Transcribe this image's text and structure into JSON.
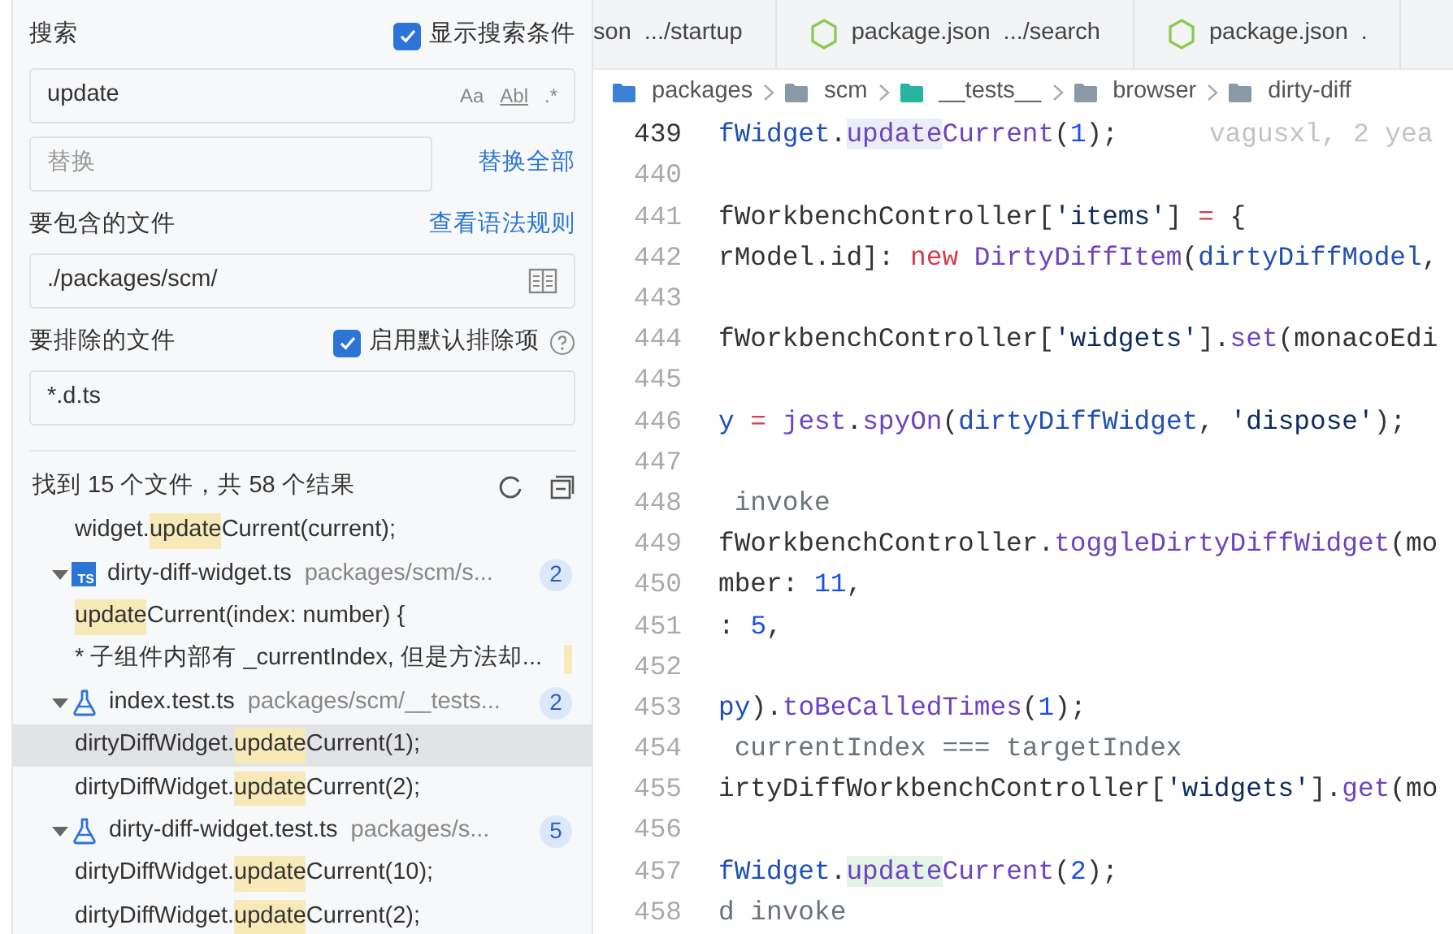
{
  "search_panel": {
    "title": "搜索",
    "show_conditions": {
      "label": "显示搜索条件",
      "checked": true
    },
    "search_field": {
      "value": "update",
      "options": [
        {
          "label": "Aa",
          "kind": "case"
        },
        {
          "label": "Abl",
          "kind": "word"
        },
        {
          "label": ".*",
          "kind": "regex"
        }
      ]
    },
    "replace_field": {
      "placeholder": "替换"
    },
    "replace_all": "替换全部",
    "include": {
      "label": "要包含的文件",
      "link": "查看语法规则",
      "value": "./packages/scm/"
    },
    "exclude": {
      "label": "要排除的文件",
      "use_defaults": {
        "label": "启用默认排除项",
        "checked": true
      },
      "value": "*.d.ts"
    },
    "summary": "找到 15 个文件，共 58 个结果",
    "leading_matches": [
      {
        "before": "widget.",
        "match": "update",
        "after": "Current(current);",
        "selected": false,
        "trailing_match": false
      }
    ],
    "files": [
      {
        "name": "dirty-diff-widget.ts",
        "path": "packages/scm/s...",
        "count": "2",
        "kind": "ts",
        "badge_label": "TS",
        "expanded": true,
        "children": [
          {
            "match": "update",
            "after": "Current(index: number) {",
            "selected": false,
            "trailing_match": false
          },
          {
            "before": "* 子组件内部有 _currentIndex, 但是方法却...",
            "selected": false,
            "trailing_match": true
          }
        ]
      },
      {
        "name": "index.test.ts",
        "path": "packages/scm/__tests...",
        "count": "2",
        "kind": "test",
        "expanded": true,
        "children": [
          {
            "before": "dirtyDiffWidget.",
            "match": "update",
            "after": "Current(1);",
            "selected": true,
            "trailing_match": false
          },
          {
            "before": "dirtyDiffWidget.",
            "match": "update",
            "after": "Current(2);",
            "selected": false,
            "trailing_match": false
          }
        ]
      },
      {
        "name": "dirty-diff-widget.test.ts",
        "path": "packages/s...",
        "count": "5",
        "kind": "test",
        "expanded": true,
        "children": [
          {
            "before": "dirtyDiffWidget.",
            "match": "update",
            "after": "Current(10);",
            "selected": false,
            "trailing_match": false
          },
          {
            "before": "dirtyDiffWidget.",
            "match": "update",
            "after": "Current(2);",
            "selected": false,
            "trailing_match": false
          }
        ]
      }
    ]
  },
  "editor": {
    "tabs": [
      {
        "name": "son",
        "dir": ".../startup",
        "icon": false,
        "selected": false
      },
      {
        "name": "package.json",
        "dir": ".../search",
        "icon": true,
        "selected": false
      },
      {
        "name": "package.json",
        "dir": ".",
        "icon": true,
        "selected": false
      }
    ],
    "breadcrumbs": [
      {
        "label": "packages",
        "color": "#3b82d6"
      },
      {
        "label": "scm",
        "color": "#8a99a6"
      },
      {
        "label": "__tests__",
        "color": "#26b5a0"
      },
      {
        "label": "browser",
        "color": "#8a99a6"
      },
      {
        "label": "dirty-diff",
        "color": "#8a99a6"
      }
    ],
    "lines": [
      {
        "number": "439",
        "current": true,
        "blame": "vagusxl, 2 yea",
        "tokens": [
          {
            "t": "fWidget",
            "kind": "var"
          },
          {
            "t": ".",
            "kind": "plain"
          },
          {
            "t": "update",
            "kind": "selection"
          },
          {
            "t": "Current",
            "kind": "fn"
          },
          {
            "t": "(",
            "kind": "plain"
          },
          {
            "t": "1",
            "kind": "num"
          },
          {
            "t": ");",
            "kind": "plain"
          }
        ]
      },
      {
        "number": "440",
        "current": false
      },
      {
        "number": "441",
        "current": false,
        "tokens": [
          {
            "t": "fWorkbenchController[",
            "kind": "plain"
          },
          {
            "t": "'items'",
            "kind": "str"
          },
          {
            "t": "] ",
            "kind": "plain"
          },
          {
            "t": "=",
            "kind": "kw"
          },
          {
            "t": " {",
            "kind": "plain"
          }
        ]
      },
      {
        "number": "442",
        "current": false,
        "tokens": [
          {
            "t": "rModel.id]: ",
            "kind": "plain"
          },
          {
            "t": "new",
            "kind": "kw"
          },
          {
            "t": " DirtyDiffItem",
            "kind": "fn"
          },
          {
            "t": "(",
            "kind": "plain"
          },
          {
            "t": "dirtyDiffModel",
            "kind": "var"
          },
          {
            "t": ",",
            "kind": "plain"
          }
        ]
      },
      {
        "number": "443",
        "current": false
      },
      {
        "number": "444",
        "current": false,
        "tokens": [
          {
            "t": "fWorkbenchController[",
            "kind": "plain"
          },
          {
            "t": "'widgets'",
            "kind": "str"
          },
          {
            "t": "].",
            "kind": "plain"
          },
          {
            "t": "set",
            "kind": "fn"
          },
          {
            "t": "(monacoEdi",
            "kind": "plain"
          }
        ]
      },
      {
        "number": "445",
        "current": false
      },
      {
        "number": "446",
        "current": false,
        "tokens": [
          {
            "t": "y",
            "kind": "var"
          },
          {
            "t": " = ",
            "kind": "kw"
          },
          {
            "t": "jest",
            "kind": "fn"
          },
          {
            "t": ".",
            "kind": "plain"
          },
          {
            "t": "spyOn",
            "kind": "fn"
          },
          {
            "t": "(",
            "kind": "plain"
          },
          {
            "t": "dirtyDiffWidget",
            "kind": "var"
          },
          {
            "t": ", ",
            "kind": "plain"
          },
          {
            "t": "'dispose'",
            "kind": "str"
          },
          {
            "t": ");",
            "kind": "plain"
          }
        ]
      },
      {
        "number": "447",
        "current": false
      },
      {
        "number": "448",
        "current": false,
        "tokens": [
          {
            "t": " invoke",
            "kind": "comment"
          }
        ]
      },
      {
        "number": "449",
        "current": false,
        "tokens": [
          {
            "t": "fWorkbenchController.",
            "kind": "plain"
          },
          {
            "t": "toggleDirtyDiffWidget",
            "kind": "fn"
          },
          {
            "t": "(mo",
            "kind": "plain"
          }
        ]
      },
      {
        "number": "450",
        "current": false,
        "tokens": [
          {
            "t": "mber: ",
            "kind": "plain"
          },
          {
            "t": "11",
            "kind": "num"
          },
          {
            "t": ",",
            "kind": "plain"
          }
        ]
      },
      {
        "number": "451",
        "current": false,
        "tokens": [
          {
            "t": ": ",
            "kind": "plain"
          },
          {
            "t": "5",
            "kind": "num"
          },
          {
            "t": ",",
            "kind": "plain"
          }
        ]
      },
      {
        "number": "452",
        "current": false
      },
      {
        "number": "453",
        "current": false,
        "tokens": [
          {
            "t": "py",
            "kind": "var"
          },
          {
            "t": ").",
            "kind": "plain"
          },
          {
            "t": "toBeCalledTimes",
            "kind": "fn"
          },
          {
            "t": "(",
            "kind": "plain"
          },
          {
            "t": "1",
            "kind": "num"
          },
          {
            "t": ");",
            "kind": "plain"
          }
        ]
      },
      {
        "number": "454",
        "current": false,
        "tokens": [
          {
            "t": " currentIndex === targetIndex",
            "kind": "comment"
          }
        ]
      },
      {
        "number": "455",
        "current": false,
        "tokens": [
          {
            "t": "irtyDiffWorkbenchController[",
            "kind": "plain"
          },
          {
            "t": "'widgets'",
            "kind": "str"
          },
          {
            "t": "].",
            "kind": "plain"
          },
          {
            "t": "get",
            "kind": "fn"
          },
          {
            "t": "(mo",
            "kind": "plain"
          }
        ]
      },
      {
        "number": "456",
        "current": false
      },
      {
        "number": "457",
        "current": false,
        "tokens": [
          {
            "t": "fWidget",
            "kind": "var"
          },
          {
            "t": ".",
            "kind": "plain"
          },
          {
            "t": "update",
            "kind": "match"
          },
          {
            "t": "Current",
            "kind": "fn"
          },
          {
            "t": "(",
            "kind": "plain"
          },
          {
            "t": "2",
            "kind": "num"
          },
          {
            "t": ");",
            "kind": "plain"
          }
        ]
      },
      {
        "number": "458",
        "current": false,
        "tokens": [
          {
            "t": "d invoke",
            "kind": "comment"
          }
        ]
      }
    ]
  }
}
